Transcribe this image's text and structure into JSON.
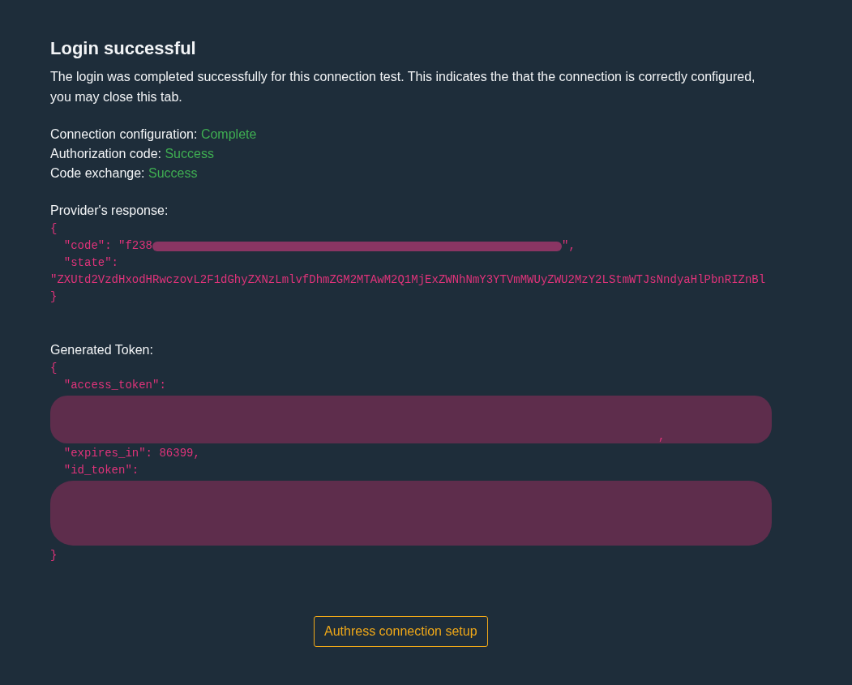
{
  "title": "Login successful",
  "message": "The login was completed successfully for this connection test. This indicates the that the connection is correctly configured, you may close this tab.",
  "statuses": [
    {
      "label": "Connection configuration:",
      "value": "Complete",
      "kind": "success"
    },
    {
      "label": "Authorization code:",
      "value": "Success",
      "kind": "success"
    },
    {
      "label": "Code exchange:",
      "value": "Success",
      "kind": "success"
    }
  ],
  "provider_response": {
    "label": "Provider's response:",
    "lines": [
      {
        "kind": "text",
        "text": "{"
      },
      {
        "kind": "masked-inline",
        "before": "  \"code\": \"f238",
        "after": "\","
      },
      {
        "kind": "text",
        "text": "  \"state\":"
      },
      {
        "kind": "text",
        "text": "\"ZXUtd2VzdHxodHRwczovL2F1dGhyZXNzLmlvfDhmZGM2MTAwM2Q1MjExZWNhNmY3YTVmMWUyZWU2MzY2LStmWTJsNndyaHlPbnRIZnBl"
      },
      {
        "kind": "text",
        "text": "}"
      }
    ]
  },
  "generated_token": {
    "label": "Generated Token:",
    "lines": [
      {
        "kind": "text",
        "text": "{"
      },
      {
        "kind": "text",
        "text": "  \"access_token\":"
      },
      {
        "kind": "masked-block",
        "tall": false,
        "after": ","
      },
      {
        "kind": "text",
        "text": "  \"expires_in\": 86399,"
      },
      {
        "kind": "text",
        "text": "  \"id_token\":"
      },
      {
        "kind": "masked-block",
        "tall": true
      },
      {
        "kind": "text",
        "text": "}"
      }
    ]
  },
  "button": "Authress connection setup"
}
